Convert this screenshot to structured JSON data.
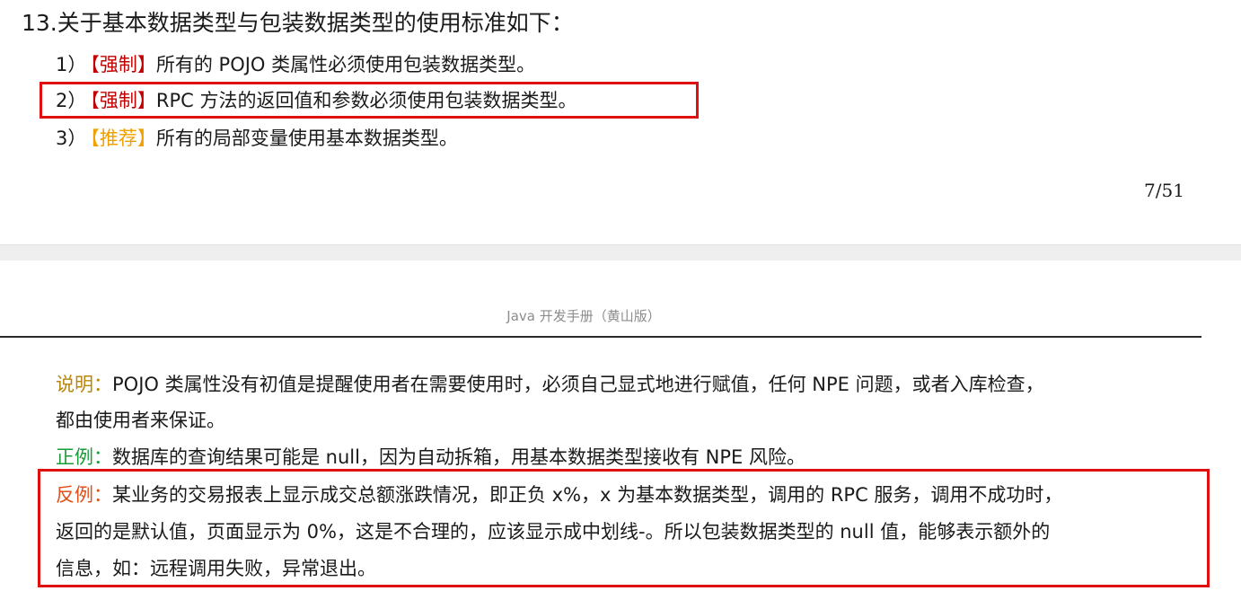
{
  "upper_page": {
    "heading": "13.关于基本数据类型与包装数据类型的使用标准如下：",
    "rules": [
      {
        "num": "1）",
        "tag": "【强制】",
        "text": "所有的 POJO 类属性必须使用包装数据类型。"
      },
      {
        "num": "2）",
        "tag": "【强制】",
        "text": "RPC 方法的返回值和参数必须使用包装数据类型。"
      },
      {
        "num": "3）",
        "tag": "【推荐】",
        "text": "所有的局部变量使用基本数据类型。"
      }
    ],
    "page_number": "7/51"
  },
  "lower_page": {
    "running_header": "Java 开发手册（黄山版）",
    "note": {
      "label": "说明：",
      "line1": "POJO 类属性没有初值是提醒使用者在需要使用时，必须自己显式地进行赋值，任何 NPE 问题，或者入库检查，",
      "line2": "都由使用者来保证。"
    },
    "positive": {
      "label": "正例：",
      "text": "数据库的查询结果可能是 null，因为自动拆箱，用基本数据类型接收有 NPE 风险。"
    },
    "negative": {
      "label": "反例：",
      "line1": "某业务的交易报表上显示成交总额涨跌情况，即正负 x%，x 为基本数据类型，调用的 RPC 服务，调用不成功时，",
      "line2": "返回的是默认值，页面显示为 0%，这是不合理的，应该显示成中划线-。所以包装数据类型的 null 值，能够表示额外的",
      "line3": "信息，如：远程调用失败，异常退出。"
    }
  },
  "colors": {
    "force_tag": "#c00000",
    "recommend_tag": "#f0a000",
    "note_label": "#b8860b",
    "positive_label": "#1a9c3a",
    "negative_label": "#e0501a",
    "highlight_box": "#e01010"
  }
}
